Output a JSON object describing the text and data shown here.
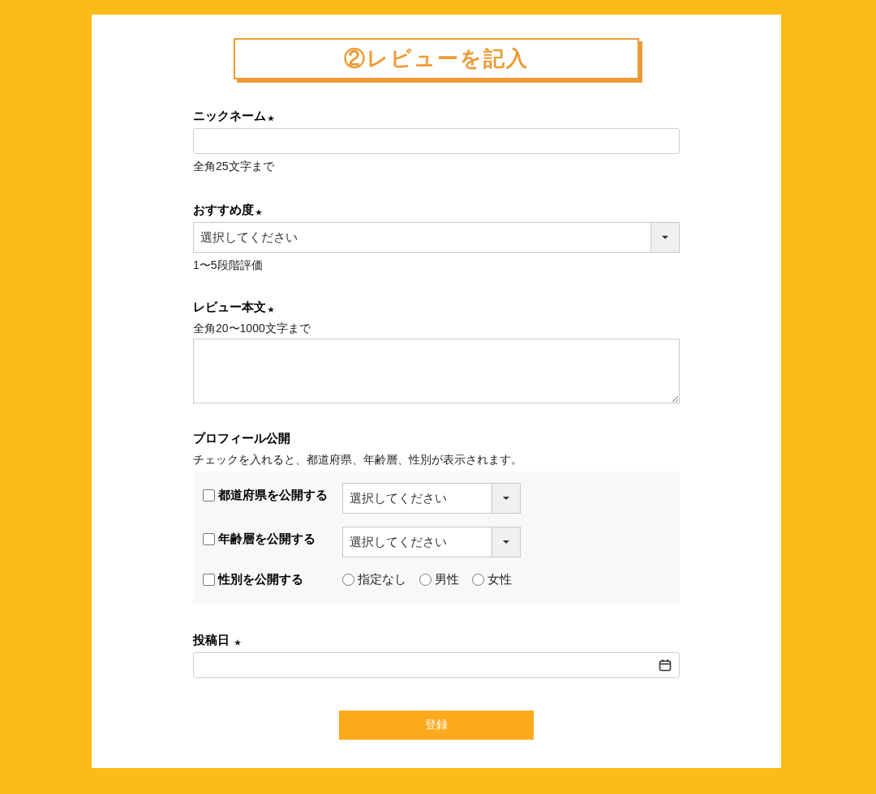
{
  "heading": "②レビューを記入",
  "fields": [
    {
      "kind": "text",
      "label": "ニックネーム",
      "required": true,
      "hint": "全角25文字まで"
    },
    {
      "kind": "select",
      "label": "おすすめ度",
      "required": true,
      "value": "選択してください",
      "hint": "1〜5段階評価"
    },
    {
      "kind": "textarea",
      "label": "レビュー本文",
      "required": true,
      "note": "全角20〜1000文字まで"
    }
  ],
  "profile": {
    "label": "プロフィール公開",
    "description": "チェックを入れると、都道府県、年齢層、性別が表示されます。",
    "rows": [
      {
        "kind": "select",
        "label": "都道府県を公開する",
        "checked": false,
        "value": "選択してください"
      },
      {
        "kind": "select",
        "label": "年齢層を公開する",
        "checked": false,
        "value": "選択してください"
      },
      {
        "kind": "radio",
        "label": "性別を公開する",
        "checked": false,
        "options": [
          {
            "label": "指定なし",
            "selected": false
          },
          {
            "label": "男性",
            "selected": false
          },
          {
            "label": "女性",
            "selected": false
          }
        ]
      }
    ]
  },
  "date_field": {
    "label": "投稿日",
    "required": true
  },
  "submit": "登録"
}
